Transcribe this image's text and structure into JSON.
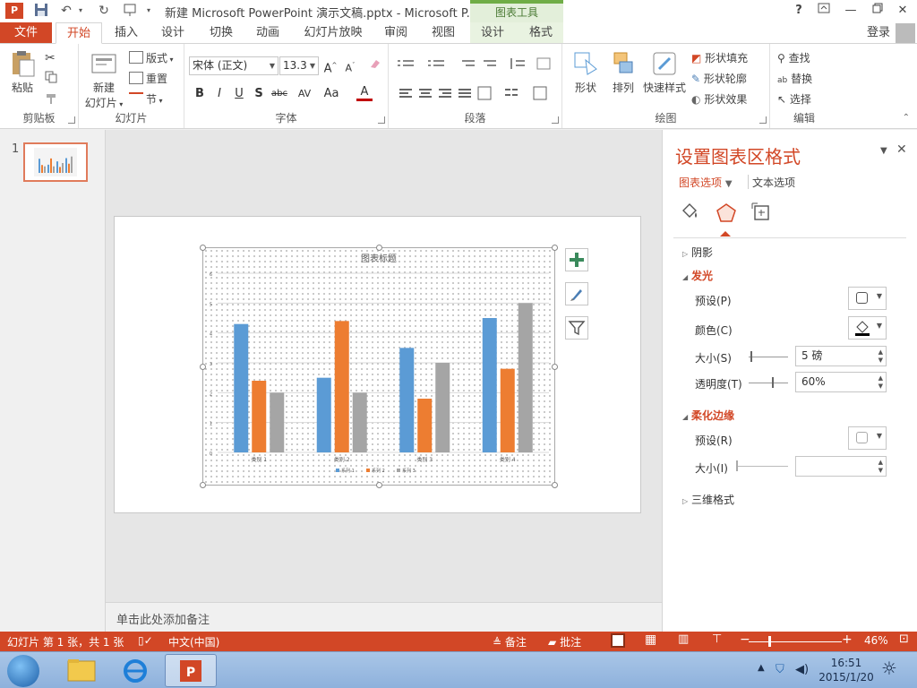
{
  "titlebar": {
    "logo_text": "P",
    "doc_title": "新建 Microsoft PowerPoint 演示文稿.pptx - Microsoft P...",
    "contextual_group": "图表工具",
    "help": "?"
  },
  "tabs": {
    "file": "文件",
    "items": [
      "开始",
      "插入",
      "设计",
      "切换",
      "动画",
      "幻灯片放映",
      "审阅",
      "视图"
    ],
    "contextual_items": [
      "设计",
      "格式"
    ],
    "login": "登录"
  },
  "ribbon": {
    "clipboard": {
      "label": "剪贴板",
      "paste": "粘贴"
    },
    "slides": {
      "label": "幻灯片",
      "new_slide_line1": "新建",
      "new_slide_line2": "幻灯片",
      "layout": "版式",
      "reset": "重置",
      "section": "节"
    },
    "font": {
      "label": "字体",
      "font_name": "宋体 (正文)",
      "font_size": "13.3",
      "bold": "B",
      "italic": "I",
      "underline": "U",
      "shadow": "S",
      "strike": "abc",
      "spacing": "AV",
      "case": "Aa",
      "color": "A"
    },
    "paragraph": {
      "label": "段落"
    },
    "drawing": {
      "label": "绘图",
      "shapes": "形状",
      "arrange": "排列",
      "quick_styles": "快速样式",
      "fill": "形状填充",
      "outline": "形状轮廓",
      "effects": "形状效果"
    },
    "editing": {
      "label": "编辑",
      "find": "查找",
      "replace": "替换",
      "select": "选择"
    }
  },
  "thumbnails": {
    "slide_number": "1"
  },
  "chart_data": {
    "type": "bar",
    "title": "图表标题",
    "categories": [
      "类别 1",
      "类别 2",
      "类别 3",
      "类别 4"
    ],
    "series": [
      {
        "name": "系列 1",
        "values": [
          4.3,
          2.5,
          3.5,
          4.5
        ],
        "color": "#5b9bd5"
      },
      {
        "name": "系列 2",
        "values": [
          2.4,
          4.4,
          1.8,
          2.8
        ],
        "color": "#ed7d31"
      },
      {
        "name": "系列 3",
        "values": [
          2.0,
          2.0,
          3.0,
          5.0
        ],
        "color": "#a5a5a5"
      }
    ],
    "ylim": [
      0,
      6
    ],
    "yticks": [
      "0",
      "1",
      "2",
      "3",
      "4",
      "5",
      "6"
    ],
    "grid": true,
    "legend": "bottom"
  },
  "notes": {
    "placeholder": "单击此处添加备注"
  },
  "format_pane": {
    "title": "设置图表区格式",
    "tab_chart_options": "图表选项",
    "tab_text_options": "文本选项",
    "shadow": "阴影",
    "glow": "发光",
    "glow_preset": "预设(P)",
    "glow_color": "颜色(C)",
    "glow_size": "大小(S)",
    "glow_size_value": "5 磅",
    "glow_transparency": "透明度(T)",
    "glow_transparency_value": "60%",
    "soft_edges": "柔化边缘",
    "soft_preset": "预设(R)",
    "soft_size": "大小(I)",
    "soft_size_value": "",
    "three_d": "三维格式"
  },
  "statusbar": {
    "slide_info": "幻灯片 第 1 张，共 1 张",
    "language": "中文(中国)",
    "notes": "备注",
    "comments": "批注",
    "zoom": "46%"
  },
  "taskbar": {
    "time": "16:51",
    "date": "2015/1/20"
  },
  "colors": {
    "accent": "#d24726",
    "contextual": "#70ad47"
  }
}
